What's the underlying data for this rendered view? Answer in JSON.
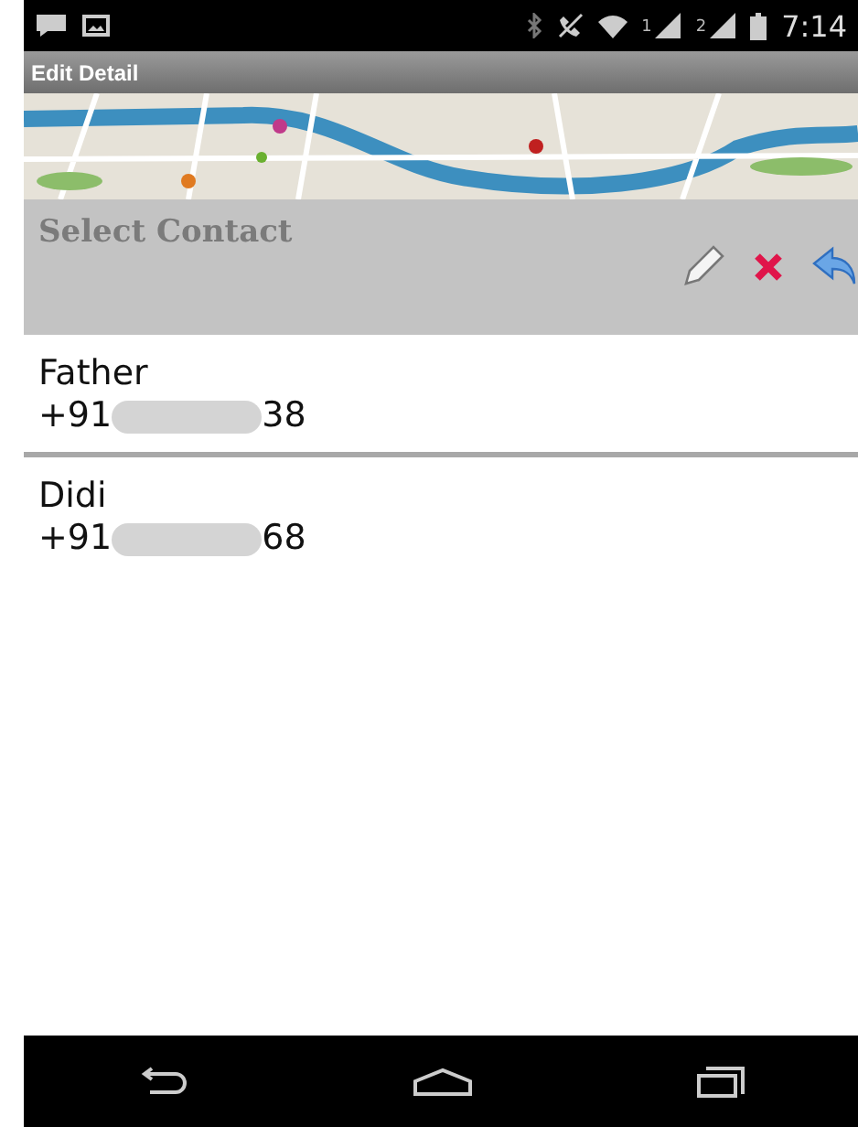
{
  "status_bar": {
    "sim_1": "1",
    "sim_2": "2",
    "time": "7:14"
  },
  "title_bar": {
    "title": "Edit Detail"
  },
  "header": {
    "title": "Select Contact"
  },
  "contacts": [
    {
      "name": "Father",
      "number_prefix": "+91",
      "number_suffix": "38"
    },
    {
      "name": "Didi",
      "number_prefix": "+91",
      "number_suffix": "68"
    }
  ]
}
